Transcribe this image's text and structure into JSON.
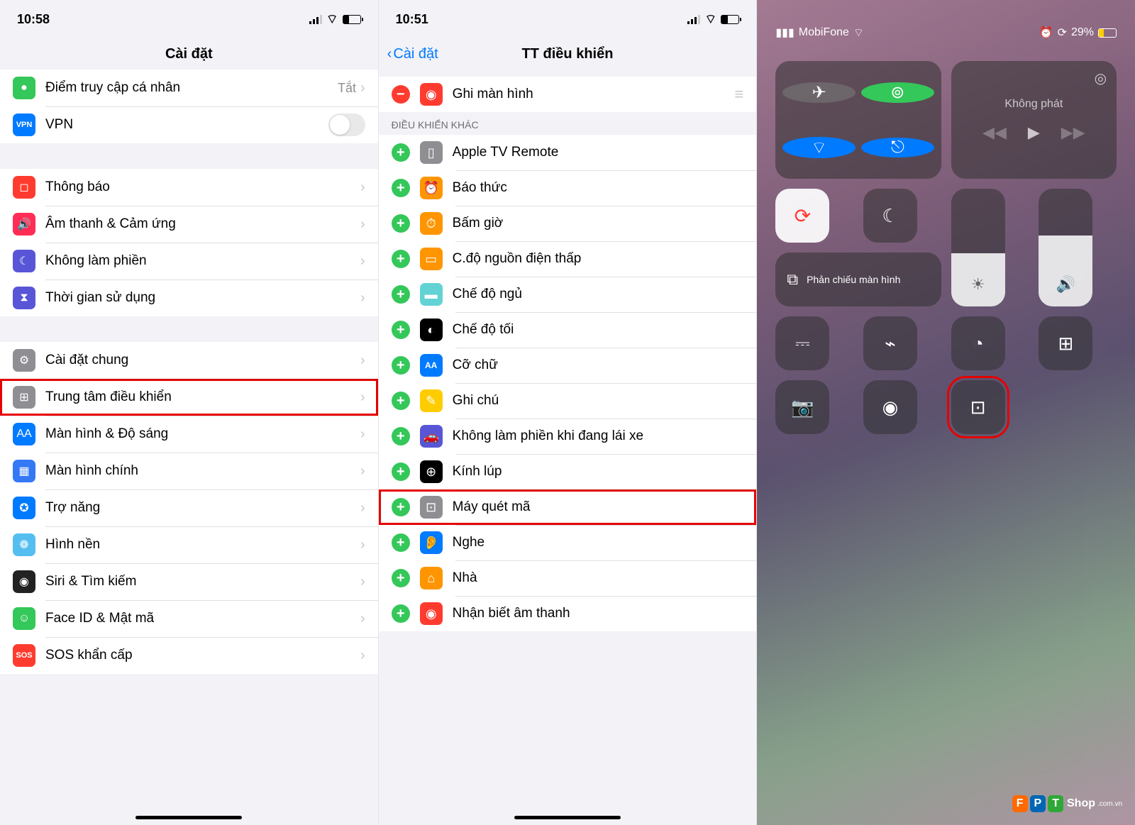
{
  "pane1": {
    "time": "10:58",
    "title": "Cài đặt",
    "rows": [
      {
        "icon": "link-icon",
        "bg": "#34c759",
        "label": "Điểm truy cập cá nhân",
        "val": "Tắt",
        "chev": true
      },
      {
        "icon": "vpn-icon",
        "bg": "#007aff",
        "label": "VPN",
        "toggle": true,
        "iconText": "VPN"
      }
    ],
    "rows2": [
      {
        "icon": "bell-icon",
        "bg": "#ff3b30",
        "label": "Thông báo",
        "chev": true,
        "glyph": "◻"
      },
      {
        "icon": "speaker-icon",
        "bg": "#ff2d55",
        "label": "Âm thanh & Cảm ứng",
        "chev": true,
        "glyph": "🔊"
      },
      {
        "icon": "moon-icon",
        "bg": "#5856d6",
        "label": "Không làm phiền",
        "chev": true,
        "glyph": "☾"
      },
      {
        "icon": "hourglass-icon",
        "bg": "#5856d6",
        "label": "Thời gian sử dụng",
        "chev": true,
        "glyph": "⧗"
      }
    ],
    "rows3": [
      {
        "icon": "gear-icon",
        "bg": "#8e8e93",
        "label": "Cài đặt chung",
        "chev": true,
        "glyph": "⚙"
      },
      {
        "icon": "control-center-icon",
        "bg": "#8e8e93",
        "label": "Trung tâm điều khiển",
        "chev": true,
        "highlight": true,
        "glyph": "⊞"
      },
      {
        "icon": "text-size-icon",
        "bg": "#007aff",
        "label": "Màn hình & Độ sáng",
        "chev": true,
        "glyph": "AA"
      },
      {
        "icon": "grid-icon",
        "bg": "#3478f6",
        "label": "Màn hình chính",
        "chev": true,
        "glyph": "▦"
      },
      {
        "icon": "accessibility-icon",
        "bg": "#007aff",
        "label": "Trợ năng",
        "chev": true,
        "glyph": "✪"
      },
      {
        "icon": "wallpaper-icon",
        "bg": "#55bef0",
        "label": "Hình nền",
        "chev": true,
        "glyph": "❁"
      },
      {
        "icon": "siri-icon",
        "bg": "#222",
        "label": "Siri & Tìm kiếm",
        "chev": true,
        "glyph": "◉"
      },
      {
        "icon": "faceid-icon",
        "bg": "#34c759",
        "label": "Face ID & Mật mã",
        "chev": true,
        "glyph": "☺"
      },
      {
        "icon": "sos-icon",
        "bg": "#ff3b30",
        "label": "SOS khẩn cấp",
        "chev": true,
        "glyph": "",
        "iconText": "SOS"
      }
    ]
  },
  "pane2": {
    "time": "10:51",
    "back": "Cài đặt",
    "title": "TT điều khiển",
    "included": [
      {
        "type": "rm",
        "icon": "record-icon",
        "bg": "#ff3b30",
        "label": "Ghi màn hình",
        "grip": true,
        "glyph": "◉"
      }
    ],
    "section": "ĐIỀU KHIỂN KHÁC",
    "more": [
      {
        "icon": "appletv-icon",
        "bg": "#8e8e93",
        "label": "Apple TV Remote",
        "glyph": "▯"
      },
      {
        "icon": "alarm-icon",
        "bg": "#ff9500",
        "label": "Báo thức",
        "glyph": "⏰"
      },
      {
        "icon": "stopwatch-icon",
        "bg": "#ff9500",
        "label": "Bấm giờ",
        "glyph": "⏱"
      },
      {
        "icon": "lowpower-icon",
        "bg": "#ff9500",
        "label": "C.độ nguồn điện thấp",
        "glyph": "▭"
      },
      {
        "icon": "sleep-icon",
        "bg": "#63d2d4",
        "label": "Chế độ ngủ",
        "glyph": "▬"
      },
      {
        "icon": "darkmode-icon",
        "bg": "#000",
        "label": "Chế độ tối",
        "glyph": "◐"
      },
      {
        "icon": "textsize-icon",
        "bg": "#007aff",
        "label": "Cỡ chữ",
        "glyph": "",
        "iconText": "AA"
      },
      {
        "icon": "notes-icon",
        "bg": "#ffcc00",
        "label": "Ghi chú",
        "glyph": "✎"
      },
      {
        "icon": "car-icon",
        "bg": "#5856d6",
        "label": "Không làm phiền khi đang lái xe",
        "glyph": "🚗"
      },
      {
        "icon": "magnifier-icon",
        "bg": "#000",
        "label": "Kính lúp",
        "glyph": "⊕"
      },
      {
        "icon": "qr-icon",
        "bg": "#8e8e93",
        "label": "Máy quét mã",
        "highlight": true,
        "glyph": "⊡"
      },
      {
        "icon": "ear-icon",
        "bg": "#007aff",
        "label": "Nghe",
        "glyph": "👂"
      },
      {
        "icon": "home-icon",
        "bg": "#ff9500",
        "label": "Nhà",
        "glyph": "⌂"
      },
      {
        "icon": "sound-icon",
        "bg": "#ff3b30",
        "label": "Nhận biết âm thanh",
        "glyph": "◉"
      }
    ]
  },
  "pane3": {
    "carrier": "MobiFone",
    "battery": "29%",
    "mediaLabel": "Không phát",
    "mirrorLabel": "Phản chiếu màn hình",
    "brightnessFill": 45,
    "volumeFill": 60,
    "quad": [
      {
        "name": "airplane",
        "bg": "rgba(120,120,120,0.6)",
        "glyph": "✈"
      },
      {
        "name": "cellular",
        "bg": "#34c759",
        "glyph": "⊚"
      },
      {
        "name": "wifi",
        "bg": "#007aff",
        "glyph": "⌔"
      },
      {
        "name": "bluetooth",
        "bg": "#007aff",
        "glyph": "⎋"
      }
    ],
    "tiles": [
      {
        "name": "voice-memo",
        "glyph": "⎓"
      },
      {
        "name": "flashlight",
        "glyph": "⌁"
      },
      {
        "name": "timer",
        "glyph": "◔"
      },
      {
        "name": "calculator",
        "glyph": "⊞"
      },
      {
        "name": "camera",
        "glyph": "📷"
      },
      {
        "name": "screen-record",
        "glyph": "◉"
      },
      {
        "name": "qr-scanner",
        "glyph": "⊡",
        "highlight": true
      }
    ]
  },
  "watermark": {
    "brand1": "F",
    "brand2": "P",
    "brand3": "T",
    "text": "Shop",
    "suffix": ".com.vn"
  }
}
